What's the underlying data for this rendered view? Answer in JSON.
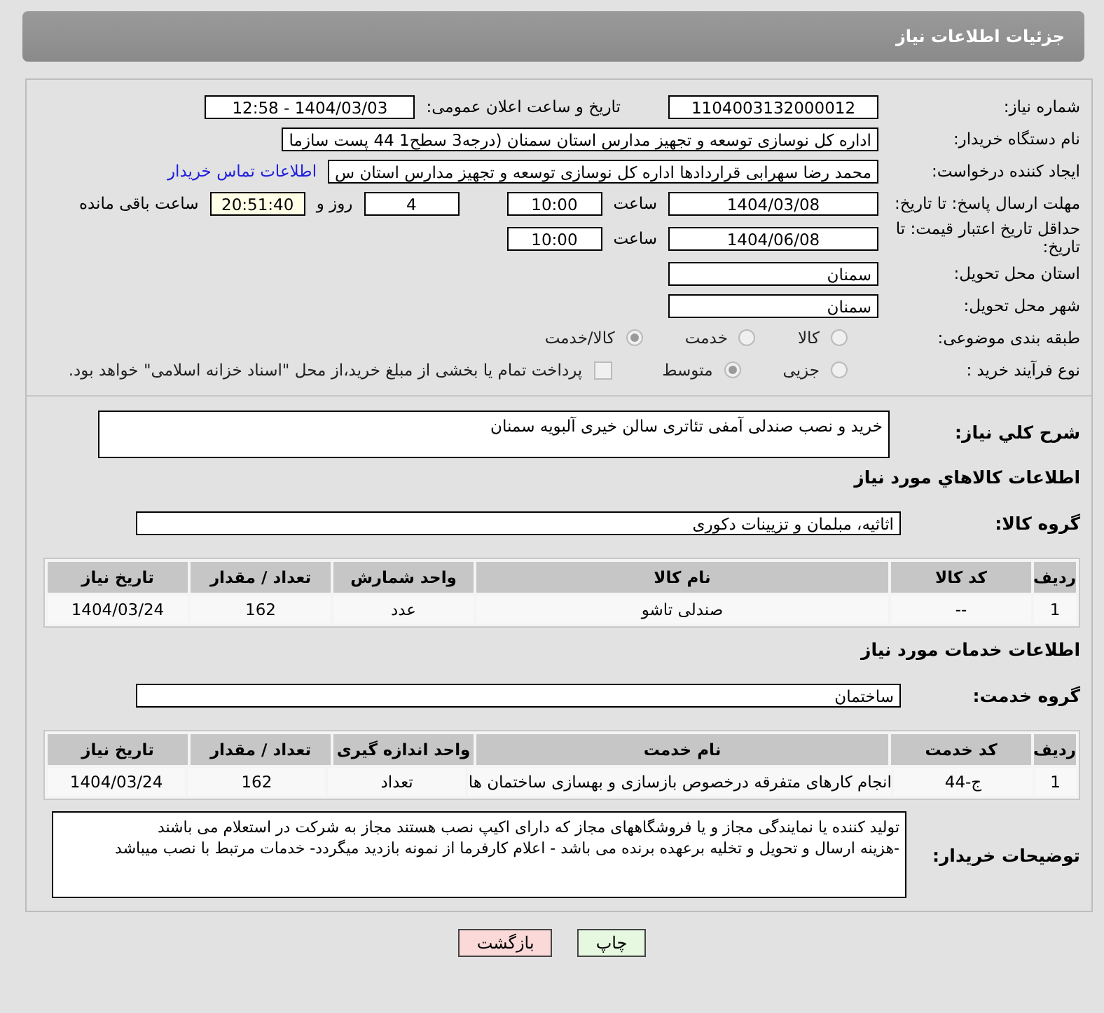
{
  "header": {
    "title": "جزئیات اطلاعات نیاز"
  },
  "need_number": {
    "label": "شماره نیاز:",
    "value": "1104003132000012"
  },
  "announce": {
    "label": "تاریخ و ساعت اعلان عمومی:",
    "value": "1404/03/03 - 12:58"
  },
  "buyer_org": {
    "label": "نام دستگاه خریدار:",
    "value": "اداره کل نوسازی   توسعه و تجهیز مدارس استان سمنان (درجه3  سطح1  44 پست سازما"
  },
  "creator": {
    "label": "ایجاد کننده درخواست:",
    "value": "محمد رضا سهرابی قراردادها اداره کل نوسازی   توسعه و تجهیز مدارس استان س",
    "link": "اطلاعات تماس خریدار"
  },
  "reply_deadline": {
    "label": "مهلت ارسال پاسخ: تا تاریخ:",
    "date": "1404/03/08",
    "time_label": "ساعت",
    "time": "10:00",
    "days": "4",
    "days_label": "روز و",
    "remaining": "20:51:40",
    "remaining_label": "ساعت باقی مانده"
  },
  "price_validity": {
    "label": "حداقل تاریخ اعتبار قیمت: تا تاریخ:",
    "date": "1404/06/08",
    "time_label": "ساعت",
    "time": "10:00"
  },
  "delivery_province": {
    "label": "استان محل تحویل:",
    "value": "سمنان"
  },
  "delivery_city": {
    "label": "شهر محل تحویل:",
    "value": "سمنان"
  },
  "subject_category": {
    "label": "طبقه بندی موضوعی:",
    "options": [
      {
        "label": "کالا",
        "selected": false
      },
      {
        "label": "خدمت",
        "selected": false
      },
      {
        "label": "کالا/خدمت",
        "selected": true
      }
    ]
  },
  "purchase_process": {
    "label": "نوع فرآیند خرید :",
    "options": [
      {
        "label": "جزیی",
        "selected": false
      },
      {
        "label": "متوسط",
        "selected": true
      }
    ],
    "treasury": {
      "label": "پرداخت تمام یا بخشی از مبلغ خرید،از محل \"اسناد خزانه اسلامی\" خواهد بود.",
      "checked": false
    }
  },
  "description": {
    "label": "شرح کلي نیاز:",
    "value": "خرید و نصب صندلی آمفی تئاتری سالن خیری آلبویه سمنان"
  },
  "goods": {
    "title": "اطلاعات کالاهاي مورد نیاز",
    "group_label": "گروه کالا:",
    "group_value": "اثاثیه، مبلمان و تزیینات دکوری",
    "columns": [
      "ردیف",
      "کد کالا",
      "نام کالا",
      "واحد شمارش",
      "تعداد / مقدار",
      "تاریخ نیاز"
    ],
    "rows": [
      [
        "1",
        "--",
        "صندلی تاشو",
        "عدد",
        "162",
        "1404/03/24"
      ]
    ]
  },
  "services": {
    "title": "اطلاعات خدمات مورد نیاز",
    "group_label": "گروه خدمت:",
    "group_value": "ساختمان",
    "columns": [
      "ردیف",
      "کد خدمت",
      "نام خدمت",
      "واحد اندازه گیری",
      "تعداد / مقدار",
      "تاریخ نیاز"
    ],
    "rows": [
      [
        "1",
        "ج-44",
        "انجام کارهای متفرقه درخصوص بازسازی و بهسازی ساختمان ها",
        "تعداد",
        "162",
        "1404/03/24"
      ]
    ]
  },
  "buyer_notes": {
    "label": "توضیحات خریدار:",
    "lines": [
      "تولید کننده یا نمایندگی مجاز و یا فروشگاههای مجاز که دارای اکیپ  نصب هستند مجاز به شرکت در استعلام می باشند",
      "-هزینه ارسال و تحویل و تخلیه  برعهده برنده می باشد - اعلام کارفرما از نمونه بازدید میگردد- خدمات مرتبط با نصب میباشد"
    ]
  },
  "buttons": [
    {
      "label": "چاپ",
      "kind": "print"
    },
    {
      "label": "بازگشت",
      "kind": "back"
    }
  ]
}
